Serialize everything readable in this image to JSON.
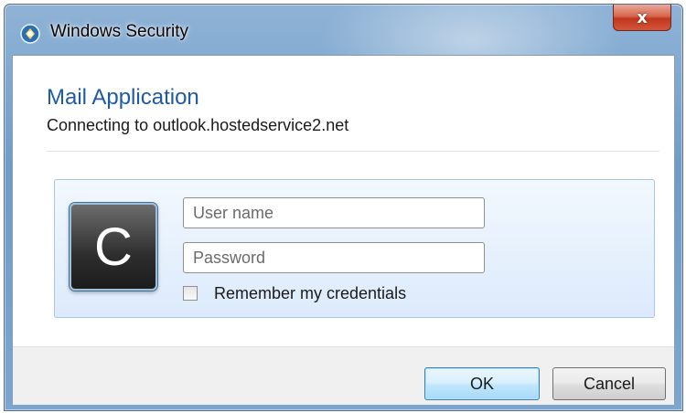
{
  "window": {
    "title": "Windows Security",
    "icon": "security-shield-icon",
    "close_glyph": "x"
  },
  "dialog": {
    "app_title": "Mail Application",
    "subtitle": "Connecting to outlook.hostedservice2.net"
  },
  "credentials": {
    "tile_icon": "user-tile-icon",
    "tile_letter": "C",
    "username": {
      "value": "",
      "placeholder": "User name"
    },
    "password": {
      "value": "",
      "placeholder": "Password"
    },
    "remember_label": "Remember my credentials",
    "remember_checked": false
  },
  "buttons": {
    "ok_label": "OK",
    "cancel_label": "Cancel"
  }
}
